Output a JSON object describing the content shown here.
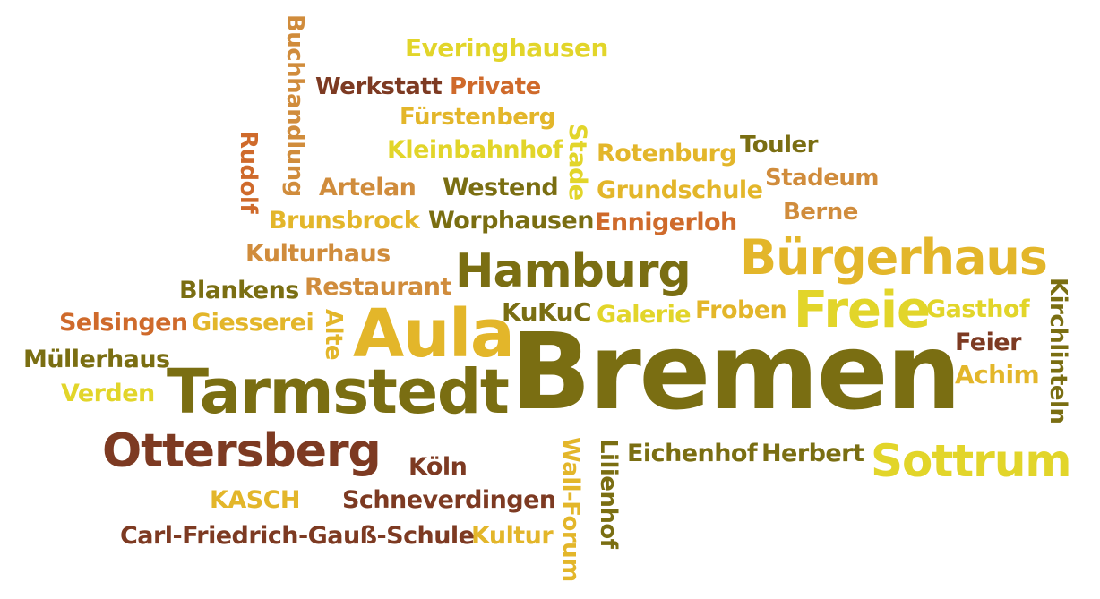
{
  "colors": {
    "olive": "#7a6e12",
    "yellow": "#e2d52a",
    "gold": "#e3b62a",
    "orange": "#cf6a2b",
    "tan": "#d08c3c",
    "brown": "#7d3a22",
    "darkbrown": "#6e2e1e"
  },
  "words": [
    {
      "text": "Bremen",
      "color": "olive"
    },
    {
      "text": "Tarmstedt",
      "color": "olive"
    },
    {
      "text": "Hamburg",
      "color": "olive"
    },
    {
      "text": "Bürgerhaus",
      "color": "gold"
    },
    {
      "text": "Aula",
      "color": "gold"
    },
    {
      "text": "Ottersberg",
      "color": "brown"
    },
    {
      "text": "Freie",
      "color": "yellow"
    },
    {
      "text": "Sottrum",
      "color": "yellow"
    },
    {
      "text": "Everinghausen",
      "color": "yellow"
    },
    {
      "text": "Werkstatt",
      "color": "brown"
    },
    {
      "text": "Private",
      "color": "orange"
    },
    {
      "text": "Fürstenberg",
      "color": "gold"
    },
    {
      "text": "Kleinbahnhof",
      "color": "yellow"
    },
    {
      "text": "Rotenburg",
      "color": "gold"
    },
    {
      "text": "Touler",
      "color": "olive"
    },
    {
      "text": "Stadeum",
      "color": "tan"
    },
    {
      "text": "Artelan",
      "color": "tan"
    },
    {
      "text": "Westend",
      "color": "olive"
    },
    {
      "text": "Grundschule",
      "color": "gold"
    },
    {
      "text": "Berne",
      "color": "tan"
    },
    {
      "text": "Brunsbrock",
      "color": "gold"
    },
    {
      "text": "Worphausen",
      "color": "olive"
    },
    {
      "text": "Ennigerloh",
      "color": "orange"
    },
    {
      "text": "Kulturhaus",
      "color": "tan"
    },
    {
      "text": "Blankens",
      "color": "olive"
    },
    {
      "text": "Restaurant",
      "color": "tan"
    },
    {
      "text": "KuKuC",
      "color": "olive"
    },
    {
      "text": "Galerie",
      "color": "yellow"
    },
    {
      "text": "Froben",
      "color": "gold"
    },
    {
      "text": "Gasthof",
      "color": "yellow"
    },
    {
      "text": "Selsingen",
      "color": "orange"
    },
    {
      "text": "Giesserei",
      "color": "gold"
    },
    {
      "text": "Feier",
      "color": "brown"
    },
    {
      "text": "Müllerhaus",
      "color": "olive"
    },
    {
      "text": "Achim",
      "color": "gold"
    },
    {
      "text": "Verden",
      "color": "yellow"
    },
    {
      "text": "Eichenhof",
      "color": "olive"
    },
    {
      "text": "Herbert",
      "color": "olive"
    },
    {
      "text": "Köln",
      "color": "brown"
    },
    {
      "text": "KASCH",
      "color": "gold"
    },
    {
      "text": "Schneverdingen",
      "color": "brown"
    },
    {
      "text": "Carl-Friedrich-Gauß-Schule",
      "color": "brown"
    },
    {
      "text": "Kultur",
      "color": "gold"
    },
    {
      "text": "Buchhandlung",
      "color": "tan"
    },
    {
      "text": "Rudolf",
      "color": "orange"
    },
    {
      "text": "Stade",
      "color": "yellow"
    },
    {
      "text": "Alte",
      "color": "gold"
    },
    {
      "text": "Kirchlinteln",
      "color": "olive"
    },
    {
      "text": "Wall-Forum",
      "color": "gold"
    },
    {
      "text": "Lilienhof",
      "color": "olive"
    }
  ]
}
